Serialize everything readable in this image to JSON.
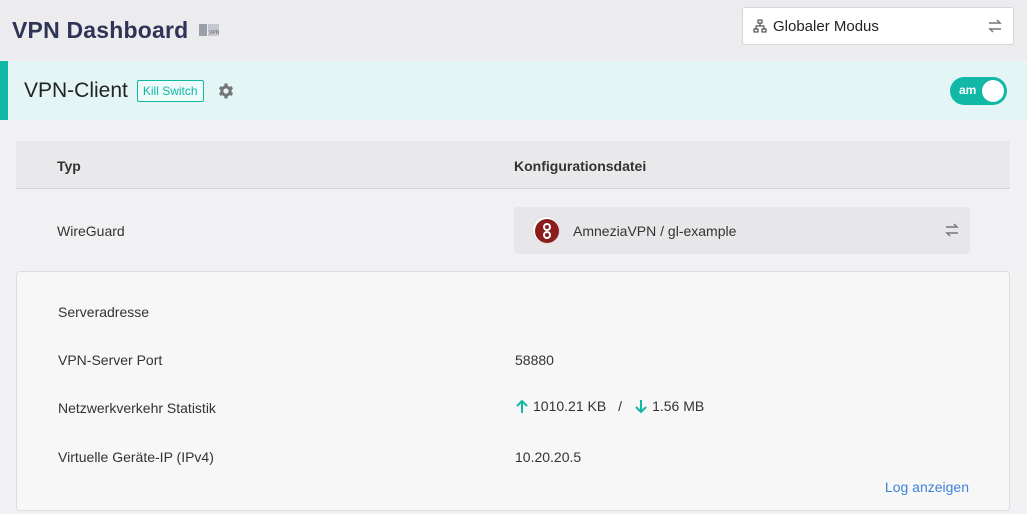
{
  "header": {
    "title": "VPN Dashboard",
    "title_icon": "vpn-book-icon",
    "mode_select": {
      "value": "Globaler Modus",
      "icon": "network-icon",
      "swap_icon": "swap-icon"
    }
  },
  "client": {
    "title": "VPN-Client",
    "kill_switch_label": "Kill Switch",
    "settings_icon": "gear-icon",
    "toggle_label": "am",
    "enabled": true
  },
  "table": {
    "columns": [
      "Typ",
      "Konfigurationsdatei"
    ],
    "row": {
      "type": "WireGuard",
      "config_name": "AmneziaVPN / gl-example",
      "config_icon": "amnezia-logo-icon"
    }
  },
  "details": {
    "server_address_label": "Serveradresse",
    "server_address_value": "",
    "port_label": "VPN-Server Port",
    "port_value": "58880",
    "traffic_label": "Netzwerkverkehr Statistik",
    "upload": "1010.21 KB",
    "separator": "/",
    "download": "1.56 MB",
    "ip_label": "Virtuelle Geräte-IP (IPv4)",
    "ip_value": "10.20.20.5",
    "log_link": "Log anzeigen"
  },
  "colors": {
    "accent": "#10b8a5",
    "link": "#3f82d6",
    "title": "#2f3457"
  }
}
